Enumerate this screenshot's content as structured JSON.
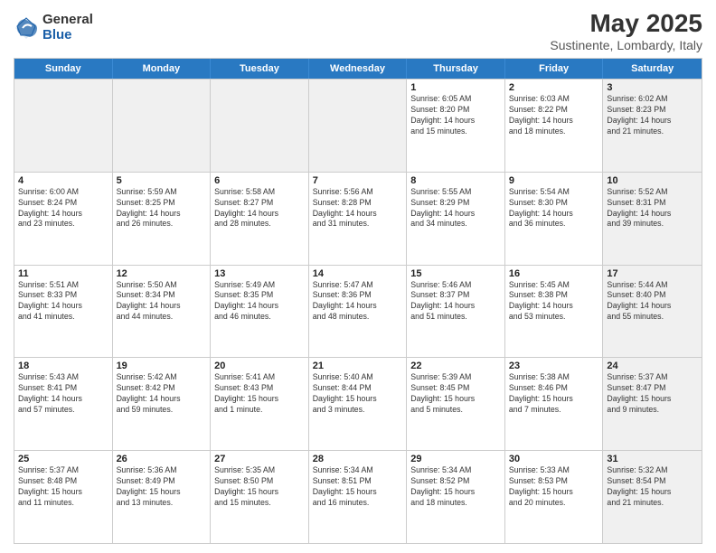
{
  "logo": {
    "general": "General",
    "blue": "Blue"
  },
  "header": {
    "month": "May 2025",
    "location": "Sustinente, Lombardy, Italy"
  },
  "weekdays": [
    "Sunday",
    "Monday",
    "Tuesday",
    "Wednesday",
    "Thursday",
    "Friday",
    "Saturday"
  ],
  "rows": [
    [
      {
        "day": "",
        "info": "",
        "shaded": true
      },
      {
        "day": "",
        "info": "",
        "shaded": true
      },
      {
        "day": "",
        "info": "",
        "shaded": true
      },
      {
        "day": "",
        "info": "",
        "shaded": true
      },
      {
        "day": "1",
        "info": "Sunrise: 6:05 AM\nSunset: 8:20 PM\nDaylight: 14 hours\nand 15 minutes."
      },
      {
        "day": "2",
        "info": "Sunrise: 6:03 AM\nSunset: 8:22 PM\nDaylight: 14 hours\nand 18 minutes."
      },
      {
        "day": "3",
        "info": "Sunrise: 6:02 AM\nSunset: 8:23 PM\nDaylight: 14 hours\nand 21 minutes.",
        "shaded": true
      }
    ],
    [
      {
        "day": "4",
        "info": "Sunrise: 6:00 AM\nSunset: 8:24 PM\nDaylight: 14 hours\nand 23 minutes."
      },
      {
        "day": "5",
        "info": "Sunrise: 5:59 AM\nSunset: 8:25 PM\nDaylight: 14 hours\nand 26 minutes."
      },
      {
        "day": "6",
        "info": "Sunrise: 5:58 AM\nSunset: 8:27 PM\nDaylight: 14 hours\nand 28 minutes."
      },
      {
        "day": "7",
        "info": "Sunrise: 5:56 AM\nSunset: 8:28 PM\nDaylight: 14 hours\nand 31 minutes."
      },
      {
        "day": "8",
        "info": "Sunrise: 5:55 AM\nSunset: 8:29 PM\nDaylight: 14 hours\nand 34 minutes."
      },
      {
        "day": "9",
        "info": "Sunrise: 5:54 AM\nSunset: 8:30 PM\nDaylight: 14 hours\nand 36 minutes."
      },
      {
        "day": "10",
        "info": "Sunrise: 5:52 AM\nSunset: 8:31 PM\nDaylight: 14 hours\nand 39 minutes.",
        "shaded": true
      }
    ],
    [
      {
        "day": "11",
        "info": "Sunrise: 5:51 AM\nSunset: 8:33 PM\nDaylight: 14 hours\nand 41 minutes."
      },
      {
        "day": "12",
        "info": "Sunrise: 5:50 AM\nSunset: 8:34 PM\nDaylight: 14 hours\nand 44 minutes."
      },
      {
        "day": "13",
        "info": "Sunrise: 5:49 AM\nSunset: 8:35 PM\nDaylight: 14 hours\nand 46 minutes."
      },
      {
        "day": "14",
        "info": "Sunrise: 5:47 AM\nSunset: 8:36 PM\nDaylight: 14 hours\nand 48 minutes."
      },
      {
        "day": "15",
        "info": "Sunrise: 5:46 AM\nSunset: 8:37 PM\nDaylight: 14 hours\nand 51 minutes."
      },
      {
        "day": "16",
        "info": "Sunrise: 5:45 AM\nSunset: 8:38 PM\nDaylight: 14 hours\nand 53 minutes."
      },
      {
        "day": "17",
        "info": "Sunrise: 5:44 AM\nSunset: 8:40 PM\nDaylight: 14 hours\nand 55 minutes.",
        "shaded": true
      }
    ],
    [
      {
        "day": "18",
        "info": "Sunrise: 5:43 AM\nSunset: 8:41 PM\nDaylight: 14 hours\nand 57 minutes."
      },
      {
        "day": "19",
        "info": "Sunrise: 5:42 AM\nSunset: 8:42 PM\nDaylight: 14 hours\nand 59 minutes."
      },
      {
        "day": "20",
        "info": "Sunrise: 5:41 AM\nSunset: 8:43 PM\nDaylight: 15 hours\nand 1 minute."
      },
      {
        "day": "21",
        "info": "Sunrise: 5:40 AM\nSunset: 8:44 PM\nDaylight: 15 hours\nand 3 minutes."
      },
      {
        "day": "22",
        "info": "Sunrise: 5:39 AM\nSunset: 8:45 PM\nDaylight: 15 hours\nand 5 minutes."
      },
      {
        "day": "23",
        "info": "Sunrise: 5:38 AM\nSunset: 8:46 PM\nDaylight: 15 hours\nand 7 minutes."
      },
      {
        "day": "24",
        "info": "Sunrise: 5:37 AM\nSunset: 8:47 PM\nDaylight: 15 hours\nand 9 minutes.",
        "shaded": true
      }
    ],
    [
      {
        "day": "25",
        "info": "Sunrise: 5:37 AM\nSunset: 8:48 PM\nDaylight: 15 hours\nand 11 minutes."
      },
      {
        "day": "26",
        "info": "Sunrise: 5:36 AM\nSunset: 8:49 PM\nDaylight: 15 hours\nand 13 minutes."
      },
      {
        "day": "27",
        "info": "Sunrise: 5:35 AM\nSunset: 8:50 PM\nDaylight: 15 hours\nand 15 minutes."
      },
      {
        "day": "28",
        "info": "Sunrise: 5:34 AM\nSunset: 8:51 PM\nDaylight: 15 hours\nand 16 minutes."
      },
      {
        "day": "29",
        "info": "Sunrise: 5:34 AM\nSunset: 8:52 PM\nDaylight: 15 hours\nand 18 minutes."
      },
      {
        "day": "30",
        "info": "Sunrise: 5:33 AM\nSunset: 8:53 PM\nDaylight: 15 hours\nand 20 minutes."
      },
      {
        "day": "31",
        "info": "Sunrise: 5:32 AM\nSunset: 8:54 PM\nDaylight: 15 hours\nand 21 minutes.",
        "shaded": true
      }
    ]
  ]
}
